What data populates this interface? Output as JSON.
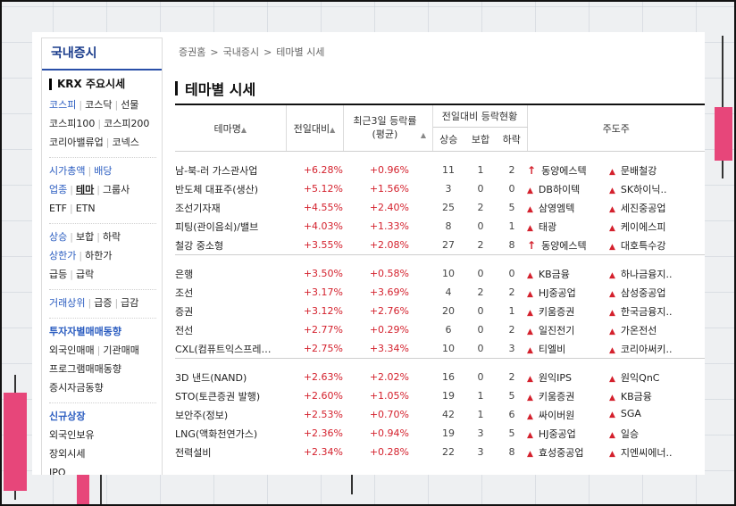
{
  "sidebar": {
    "title": "국내증시",
    "krx_head": "KRX 주요시세",
    "rows_main": [
      [
        "코스피",
        "코스닥",
        "선물"
      ],
      [
        "코스피100",
        "코스피200"
      ],
      [
        "코리아밸류업",
        "코넥스"
      ]
    ],
    "row_cap": [
      "시가총액",
      "배당"
    ],
    "row_theme": [
      "업종",
      "테마",
      "그룹사"
    ],
    "row_etf": [
      "ETF",
      "ETN"
    ],
    "row_updown": [
      "상승",
      "보합",
      "하락"
    ],
    "row_limit": [
      "상한가",
      "하한가"
    ],
    "row_surge": [
      "급등",
      "급락"
    ],
    "row_volume": [
      "거래상위",
      "급증",
      "급감"
    ],
    "investor_head": "투자자별매매동향",
    "investor_rows": [
      "외국인매매",
      "기관매매",
      "프로그램매매동향",
      "증시자금동향"
    ],
    "ipo_head": "신규상장",
    "ipo_rows": [
      "외국인보유",
      "장외시세",
      "IPO"
    ]
  },
  "breadcrumb": [
    "증권홈",
    "국내증시",
    "테마별 시세"
  ],
  "page_title": "테마별 시세",
  "table": {
    "col_theme": "테마명",
    "col_change": "전일대비",
    "col_3day": "최근3일 등락률(평균)",
    "col_status": "전일대비 등락현황",
    "col_up": "상승",
    "col_flat": "보합",
    "col_down": "하락",
    "col_leaders": "주도주",
    "groups": [
      [
        {
          "name": "남-북-러 가스관사업",
          "change": "+6.28%",
          "avg3": "+0.96%",
          "up": "11",
          "flat": "1",
          "down": "2",
          "l1": "동양에스텍",
          "l1_icon": "arrow",
          "l2": "문배철강",
          "l2_icon": "tri"
        },
        {
          "name": "반도체 대표주(생산)",
          "change": "+5.12%",
          "avg3": "+1.56%",
          "up": "3",
          "flat": "0",
          "down": "0",
          "l1": "DB하이텍",
          "l1_icon": "tri",
          "l2": "SK하이닉..",
          "l2_icon": "tri"
        },
        {
          "name": "조선기자재",
          "change": "+4.55%",
          "avg3": "+2.40%",
          "up": "25",
          "flat": "2",
          "down": "5",
          "l1": "삼영엠텍",
          "l1_icon": "tri",
          "l2": "세진중공업",
          "l2_icon": "tri"
        },
        {
          "name": "피팅(관이음쇠)/밸브",
          "change": "+4.03%",
          "avg3": "+1.33%",
          "up": "8",
          "flat": "0",
          "down": "1",
          "l1": "태광",
          "l1_icon": "tri",
          "l2": "케이에스피",
          "l2_icon": "tri"
        },
        {
          "name": "철강 중소형",
          "change": "+3.55%",
          "avg3": "+2.08%",
          "up": "27",
          "flat": "2",
          "down": "8",
          "l1": "동양에스텍",
          "l1_icon": "arrow",
          "l2": "대호특수강",
          "l2_icon": "tri"
        }
      ],
      [
        {
          "name": "은행",
          "change": "+3.50%",
          "avg3": "+0.58%",
          "up": "10",
          "flat": "0",
          "down": "0",
          "l1": "KB금융",
          "l1_icon": "tri",
          "l2": "하나금융지..",
          "l2_icon": "tri"
        },
        {
          "name": "조선",
          "change": "+3.17%",
          "avg3": "+3.69%",
          "up": "4",
          "flat": "2",
          "down": "2",
          "l1": "HJ중공업",
          "l1_icon": "tri",
          "l2": "삼성중공업",
          "l2_icon": "tri"
        },
        {
          "name": "증권",
          "change": "+3.12%",
          "avg3": "+2.76%",
          "up": "20",
          "flat": "0",
          "down": "1",
          "l1": "키움증권",
          "l1_icon": "tri",
          "l2": "한국금융지..",
          "l2_icon": "tri"
        },
        {
          "name": "전선",
          "change": "+2.77%",
          "avg3": "+0.29%",
          "up": "6",
          "flat": "0",
          "down": "2",
          "l1": "일진전기",
          "l1_icon": "tri",
          "l2": "가온전선",
          "l2_icon": "tri"
        },
        {
          "name": "CXL(컴퓨트익스프레…",
          "change": "+2.75%",
          "avg3": "+3.34%",
          "up": "10",
          "flat": "0",
          "down": "3",
          "l1": "티엘비",
          "l1_icon": "tri",
          "l2": "코리아써키..",
          "l2_icon": "tri"
        }
      ],
      [
        {
          "name": "3D 낸드(NAND)",
          "change": "+2.63%",
          "avg3": "+2.02%",
          "up": "16",
          "flat": "0",
          "down": "2",
          "l1": "원익IPS",
          "l1_icon": "tri",
          "l2": "원익QnC",
          "l2_icon": "tri"
        },
        {
          "name": "STO(토큰증권 발행)",
          "change": "+2.60%",
          "avg3": "+1.05%",
          "up": "19",
          "flat": "1",
          "down": "5",
          "l1": "키움증권",
          "l1_icon": "tri",
          "l2": "KB금융",
          "l2_icon": "tri"
        },
        {
          "name": "보안주(정보)",
          "change": "+2.53%",
          "avg3": "+0.70%",
          "up": "42",
          "flat": "1",
          "down": "6",
          "l1": "싸이버원",
          "l1_icon": "tri",
          "l2": "SGA",
          "l2_icon": "tri"
        },
        {
          "name": "LNG(액화천연가스)",
          "change": "+2.36%",
          "avg3": "+0.94%",
          "up": "19",
          "flat": "3",
          "down": "5",
          "l1": "HJ중공업",
          "l1_icon": "tri",
          "l2": "일승",
          "l2_icon": "tri"
        },
        {
          "name": "전력설비",
          "change": "+2.34%",
          "avg3": "+0.28%",
          "up": "22",
          "flat": "3",
          "down": "8",
          "l1": "효성중공업",
          "l1_icon": "tri",
          "l2": "지엔씨에너..",
          "l2_icon": "tri"
        }
      ]
    ]
  },
  "colors": {
    "up": "#d4212d",
    "link": "#2a5cc0",
    "title": "#1a3c8c",
    "candle": "#e7467a"
  }
}
